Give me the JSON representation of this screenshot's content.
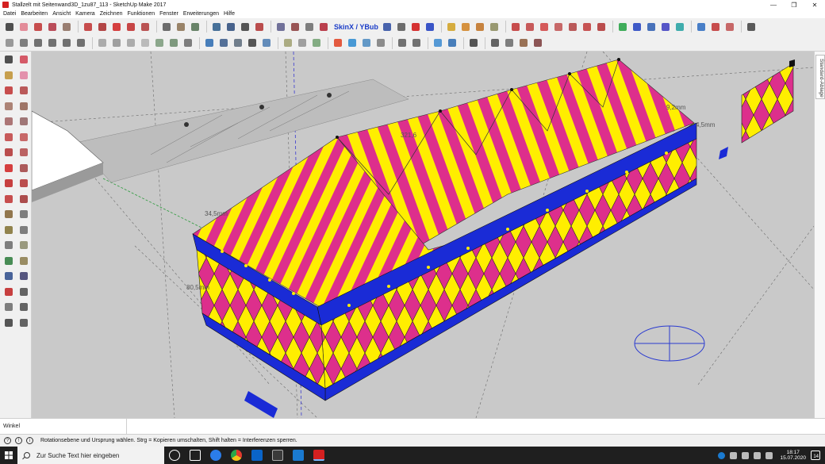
{
  "window": {
    "title": "Stallzelt mit Seitenwand3D_1zu87_113 - SketchUp Make 2017",
    "minimize": "—",
    "maximize": "❐",
    "close": "✕"
  },
  "menu": [
    "Datei",
    "Bearbeiten",
    "Ansicht",
    "Kamera",
    "Zeichnen",
    "Funktionen",
    "Fenster",
    "Erweiterungen",
    "Hilfe"
  ],
  "toolbar1": {
    "skinx_label": "SkinX / YBub"
  },
  "side_panel": {
    "tab_label": "Standard-Ablage"
  },
  "viewport": {
    "dimensions": {
      "d1": "321,6",
      "d2": "34,5mm",
      "d3": "80,5mm",
      "d4": "9,2mm",
      "d5": "4,5mm"
    },
    "colors": {
      "background": "#c9c9c9",
      "tent_yellow": "#ffee00",
      "tent_magenta": "#dd2f8c",
      "trim_blue": "#1a2bd6"
    }
  },
  "measurement": {
    "label": "Winkel"
  },
  "status": {
    "text": "Rotationsebene und Ursprung wählen. Strg = Kopieren umschalten, Shift halten = Interferenzen sperren.",
    "icon1": "?",
    "icon2": "!",
    "icon3": "i"
  },
  "taskbar": {
    "search_placeholder": "Zur Suche Text hier eingeben",
    "time": "18:17",
    "date": "15.07.2020",
    "notifications": "14",
    "apps": [
      "task-view-icon",
      "edge-icon",
      "chrome-icon",
      "outlook-icon",
      "store-icon",
      "app-icon",
      "sketchup-icon"
    ]
  }
}
